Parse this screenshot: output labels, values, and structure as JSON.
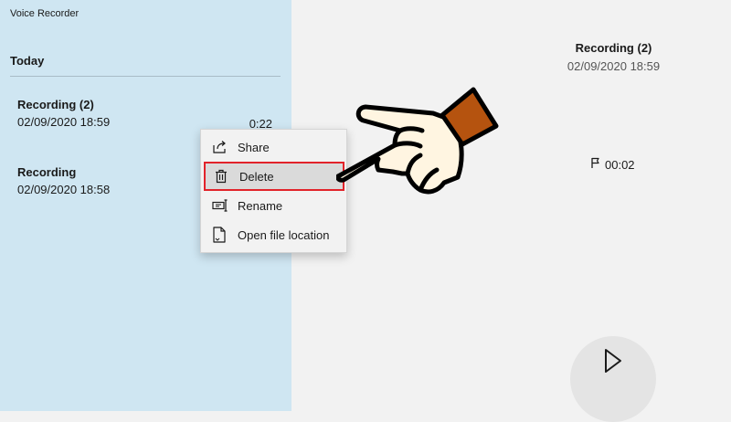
{
  "app": {
    "title": "Voice Recorder"
  },
  "list": {
    "group_header": "Today",
    "items": [
      {
        "name": "Recording (2)",
        "date": "02/09/2020 18:59",
        "duration": "0:22"
      },
      {
        "name": "Recording",
        "date": "02/09/2020 18:58"
      }
    ]
  },
  "detail": {
    "title": "Recording (2)",
    "date": "02/09/2020 18:59",
    "marker_time": "00:02"
  },
  "context_menu": {
    "items": [
      {
        "label": "Share",
        "icon": "share-icon"
      },
      {
        "label": "Delete",
        "icon": "trash-icon",
        "highlighted": true
      },
      {
        "label": "Rename",
        "icon": "rename-icon"
      },
      {
        "label": "Open file location",
        "icon": "file-icon"
      }
    ]
  },
  "colors": {
    "left_pane_bg": "#cfe6f2",
    "right_pane_bg": "#f2f2f2",
    "highlight_border": "#e2232a",
    "hand_fill": "#fff5e1",
    "cuff_fill": "#b5530f"
  },
  "icons": {
    "flag": "flag-icon",
    "play": "play-icon",
    "pointer": "pointing-hand-icon"
  }
}
